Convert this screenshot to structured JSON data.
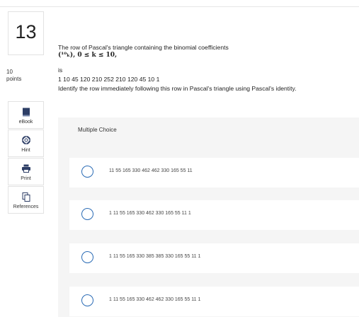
{
  "question": {
    "number": "13",
    "points_value": "10",
    "points_label": "points",
    "lines": [
      "The row of Pascal's triangle containing the binomial coefficients",
      "(¹⁰ₖ), 0 ≤ k ≤ 10,",
      "is",
      "1 10 45 120 210 252 210 120 45 10 1",
      "Identify the row immediately following this row in Pascal's triangle using Pascal's identity."
    ]
  },
  "tools": [
    {
      "label": "eBook",
      "icon": "book-icon"
    },
    {
      "label": "Hint",
      "icon": "lifebuoy-icon"
    },
    {
      "label": "Print",
      "icon": "printer-icon"
    },
    {
      "label": "References",
      "icon": "documents-icon"
    }
  ],
  "multiple_choice": {
    "label": "Multiple Choice",
    "options": [
      "11 55 165 330 462 462 330 165 55 11",
      "1 11 55 165 330 462 330 165 55 11 1",
      "1 11 55 165 330 385 385 330 165 55 11 1",
      "1 11 55 165 330 462 462 330 165 55 11 1"
    ]
  },
  "colors": {
    "accent": "#2a6bb5",
    "panel_bg": "#f5f5f5",
    "border": "#e2e2e2"
  }
}
